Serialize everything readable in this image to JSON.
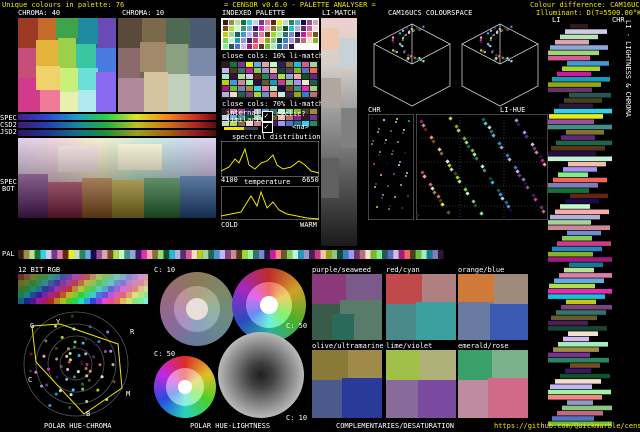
{
  "header": {
    "unique_colours": "Unique colours in palette: 76",
    "title": "= CENSOR v0.6.0 - PALETTE ANALYSER =",
    "colour_difference": "Colour difference: CAM16UCS",
    "illuminant": "Illuminant: D(T=5500.00°K)"
  },
  "labels": {
    "chroma40": "CHROMA: 40",
    "chroma10": "CHROMA: 10",
    "indexed_palette": "INDEXED PALETTE",
    "li_match": "LI-MATCH",
    "cam16ucs": "CAM16UCS COLOURSPACE",
    "li": "LI",
    "chr": "CHR",
    "spec": "SPEC",
    "csd2": "CSD2",
    "jsd2": "JSD2",
    "spec_bot": "SPEC",
    "bot": "BOT",
    "close_cols_10": "close cols: 10% li-match",
    "close_cols_70": "close cols: 70% li-match",
    "internal_similarity": "internal\nsimilarity",
    "cyclic": "cyclic?",
    "na": "<na>",
    "spectral_distribution": "spectral distribution",
    "wl_start": "4100",
    "wl_end": "6650",
    "temperature": "temperature",
    "cold": "COLD",
    "warm": "WARM",
    "chr2": "CHR",
    "li_hue": "LI-HUE",
    "pal": "PAL",
    "bit12": "12 BIT RGB",
    "c10": "C: 10",
    "c50a": "C: 50",
    "c50b": "C: 50",
    "c10b": "C: 10",
    "purple_seaweed": "purple/seaweed",
    "red_cyan": "red/cyan",
    "orange_blue": "orange/blue",
    "olive_ultramarine": "olive/ultramarine",
    "lime_violet": "lime/violet",
    "emerald_rose": "emerald/rose",
    "polar_hue_chroma": "POLAR HUE-CHROMA",
    "polar_hue_lightness": "POLAR HUE-LIGHTNESS",
    "complementaries": "COMPLEMENTARIES/DESATURATION",
    "url": "https://github.com/Quickmarble/censor",
    "vert_label": "LI - LIGHTNESS & CHROMA",
    "g": "G",
    "y": "Y",
    "r": "R",
    "c": "C",
    "m": "M",
    "b": "B"
  },
  "colors": {
    "accent": "#f2e600",
    "frame": "#888888"
  }
}
